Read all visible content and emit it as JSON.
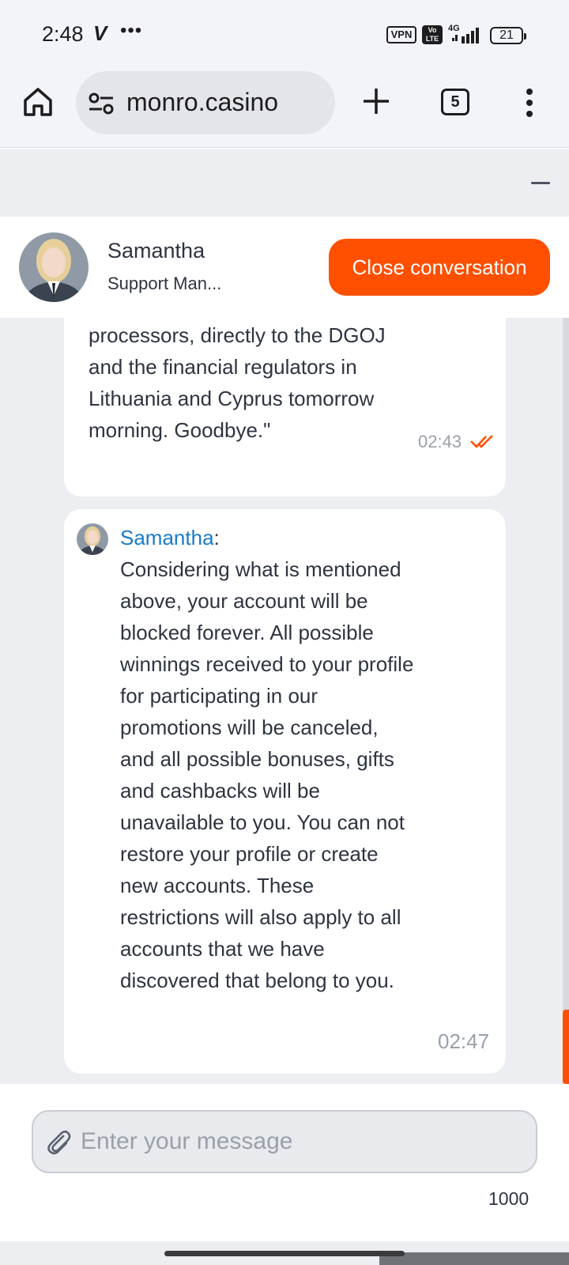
{
  "status_bar": {
    "time": "2:48",
    "carrier_mark": "V",
    "more_indicator": "•••",
    "vpn": "VPN",
    "volte": "Vo LTE",
    "network": "4G",
    "battery": "21"
  },
  "browser": {
    "url": "monro.casino",
    "tab_count": "5",
    "icons": [
      "home-icon",
      "site-settings-icon",
      "new-tab-icon",
      "tab-switcher-icon",
      "overflow-menu-icon"
    ]
  },
  "widget": {
    "agent_name": "Samantha",
    "agent_role": "Support Man...",
    "close_button": "Close conversation",
    "accent_color": "#ff4f00"
  },
  "messages": [
    {
      "text": "processors, directly to the DGOJ and the financial regulators in Lithuania and Cyprus tomorrow morning. Goodbye.\"",
      "time": "02:43",
      "status": "read"
    },
    {
      "sender": "Samantha",
      "separator": ":",
      "text": "Considering what is mentioned above, your account will be blocked forever. All possible winnings received to your profile for participating in our promotions will be canceled, and all possible bonuses, gifts and cashbacks will be unavailable to you. You can not restore your profile or create new accounts. These restrictions will also apply to all accounts that we have discovered that belong to you.",
      "time": "02:47",
      "sender_color": "#1a7ac8"
    }
  ],
  "composer": {
    "placeholder": "Enter your message",
    "char_limit": "1000"
  }
}
